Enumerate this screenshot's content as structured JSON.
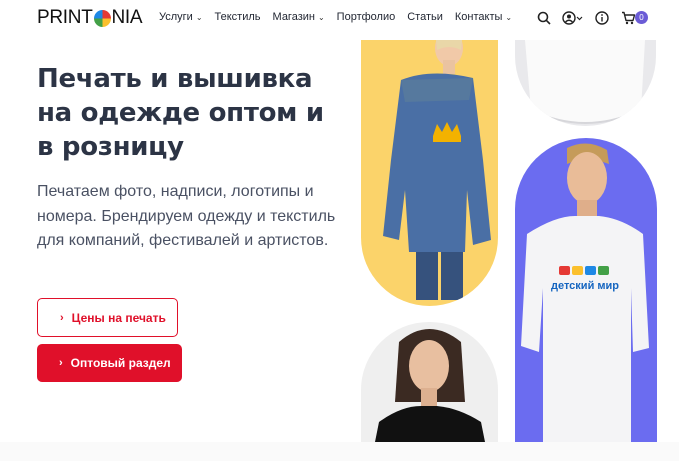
{
  "brand": {
    "logo_part1": "PRINT",
    "logo_part2": "NIA"
  },
  "nav": {
    "items": [
      {
        "label": "Услуги",
        "dropdown": true
      },
      {
        "label": "Текстиль",
        "dropdown": false
      },
      {
        "label": "Магазин",
        "dropdown": true
      },
      {
        "label": "Портфолио",
        "dropdown": false
      },
      {
        "label": "Статьи",
        "dropdown": false
      },
      {
        "label": "Контакты",
        "dropdown": true
      }
    ]
  },
  "tools": {
    "cart_count": "0"
  },
  "hero": {
    "title": "Печать и вышивка на одежде оптом и в розницу",
    "subtitle": "Печатаем фото, надписи, логотипы и номера. Брендируем одежду и текстиль для компаний, фестивалей и артистов.",
    "btn_prices": "Цены на печать",
    "btn_wholesale": "Оптовый раздел"
  },
  "images": {
    "shirt_print_text": "детский мир"
  },
  "colors": {
    "accent_red": "#e0102a",
    "badge_purple": "#6b5cd6",
    "kid_bg": "#fbd36a",
    "man_bg": "#6b6cf0"
  }
}
